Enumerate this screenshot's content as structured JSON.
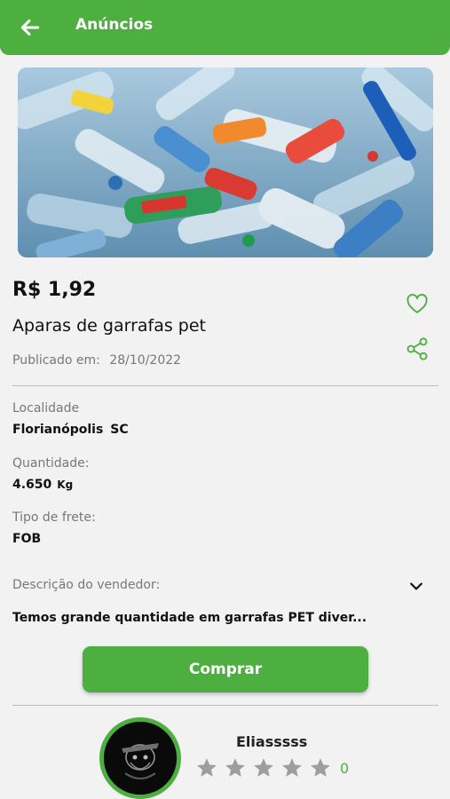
{
  "appbar": {
    "title": "Anúncios",
    "back_icon": "arrow-left-icon"
  },
  "colors": {
    "accent": "#4caf3f",
    "background": "#f2f2f2",
    "muted_text": "#777777",
    "star_empty": "#9e9e9e"
  },
  "hero": {
    "image": "plastic-pet-bottles-photo"
  },
  "product": {
    "price": "R$ 1,92",
    "title": "Aparas de garrafas pet",
    "published_label": "Publicado em:",
    "published_date": "28/10/2022",
    "favorite_icon": "heart-outline-icon",
    "share_icon": "share-icon"
  },
  "details": {
    "location_label": "Localidade",
    "location_city": "Florianópolis",
    "location_state": "SC",
    "quantity_label": "Quantidade:",
    "quantity_value": "4.650",
    "quantity_unit": "Kg",
    "freight_label": "Tipo de frete:",
    "freight_value": "FOB",
    "description_label": "Descrição do vendedor:",
    "description_text": "Temos grande quantidade em garrafas PET diver...",
    "expand_icon": "chevron-down-icon"
  },
  "buy_button": {
    "label": "Comprar"
  },
  "seller": {
    "name": "Eliasssss",
    "avatar": "seller-avatar",
    "rating_stars": 5,
    "rating_filled": 0,
    "rating_count": "0"
  }
}
